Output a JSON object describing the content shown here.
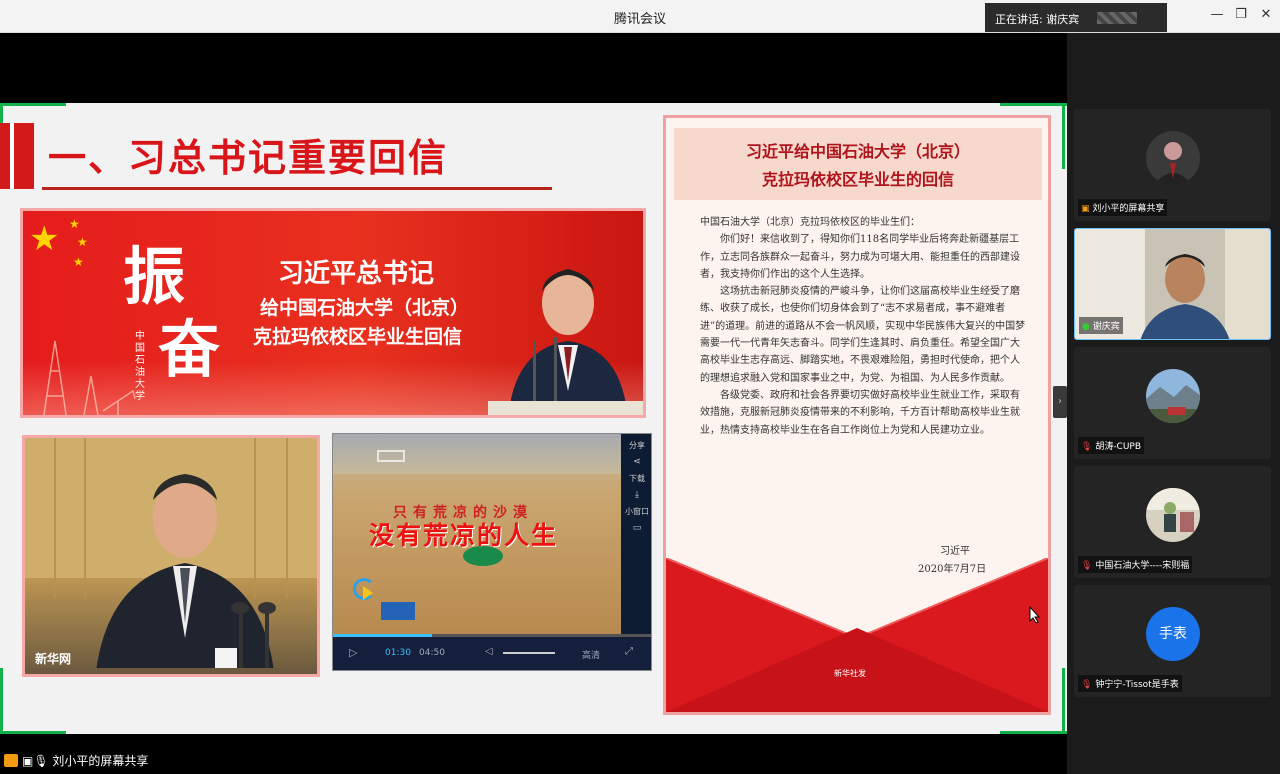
{
  "window": {
    "title": "腾讯会议",
    "speaking": "正在讲话: 谢庆宾"
  },
  "slide": {
    "heading": "一、习总书记重要回信",
    "banner": {
      "big_char_1": "振",
      "big_char_2": "奋",
      "line1": "习近平总书记",
      "line2": "给中国石油大学（北京）",
      "line3": "克拉玛依校区毕业生回信",
      "vertical": "中国石油大学"
    },
    "photo_watermark": "新华网",
    "video": {
      "slogan_top": "只有荒凉的沙漠",
      "slogan": "没有荒凉的人生",
      "side": [
        "分享",
        "下载",
        "小窗口"
      ],
      "current_time": "01:30",
      "total_time": "04:50",
      "quality": "高清",
      "progress": 0.31
    },
    "letter": {
      "title1": "习近平给中国石油大学（北京）",
      "title2": "克拉玛依校区毕业生的回信",
      "greeting": "中国石油大学（北京）克拉玛依校区的毕业生们：",
      "para1": "你们好！来信收到了，得知你们118名同学毕业后将奔赴新疆基层工作，立志同各族群众一起奋斗，努力成为可堪大用、能担重任的西部建设者，我支持你们作出的这个人生选择。",
      "para2": "这场抗击新冠肺炎疫情的严峻斗争，让你们这届高校毕业生经受了磨练、收获了成长，也使你们切身体会到了“志不求易者成，事不避难者进”的道理。前进的道路从不会一帆风顺，实现中华民族伟大复兴的中国梦需要一代一代青年矢志奋斗。同学们生逢其时、肩负重任。希望全国广大高校毕业生志存高远、脚踏实地，不畏艰难险阻，勇担时代使命，把个人的理想追求融入党和国家事业之中，为党、为祖国、为人民多作贡献。",
      "para3": "各级党委、政府和社会各界要切实做好高校毕业生就业工作，采取有效措施，克服新冠肺炎疫情带来的不利影响，千方百计帮助高校毕业生就业，热情支持高校毕业生在各自工作岗位上为党和人民建功立业。",
      "sign": "习近平",
      "date": "2020年7月7日",
      "source": "新华社发"
    }
  },
  "participants": [
    {
      "name": "刘小平的屏幕共享"
    },
    {
      "name": "谢庆宾"
    },
    {
      "name": "胡涛-CUPB"
    },
    {
      "name": "中国石油大学----宋则福"
    },
    {
      "name": "钟宁宁-Tissot是手表",
      "avatar_text": "手表"
    }
  ],
  "bottom_label": "刘小平的屏幕共享",
  "colors": {
    "accent_red": "#d8161a",
    "frame_green": "#12b04a",
    "avatar_blue": "#1a73e8"
  }
}
